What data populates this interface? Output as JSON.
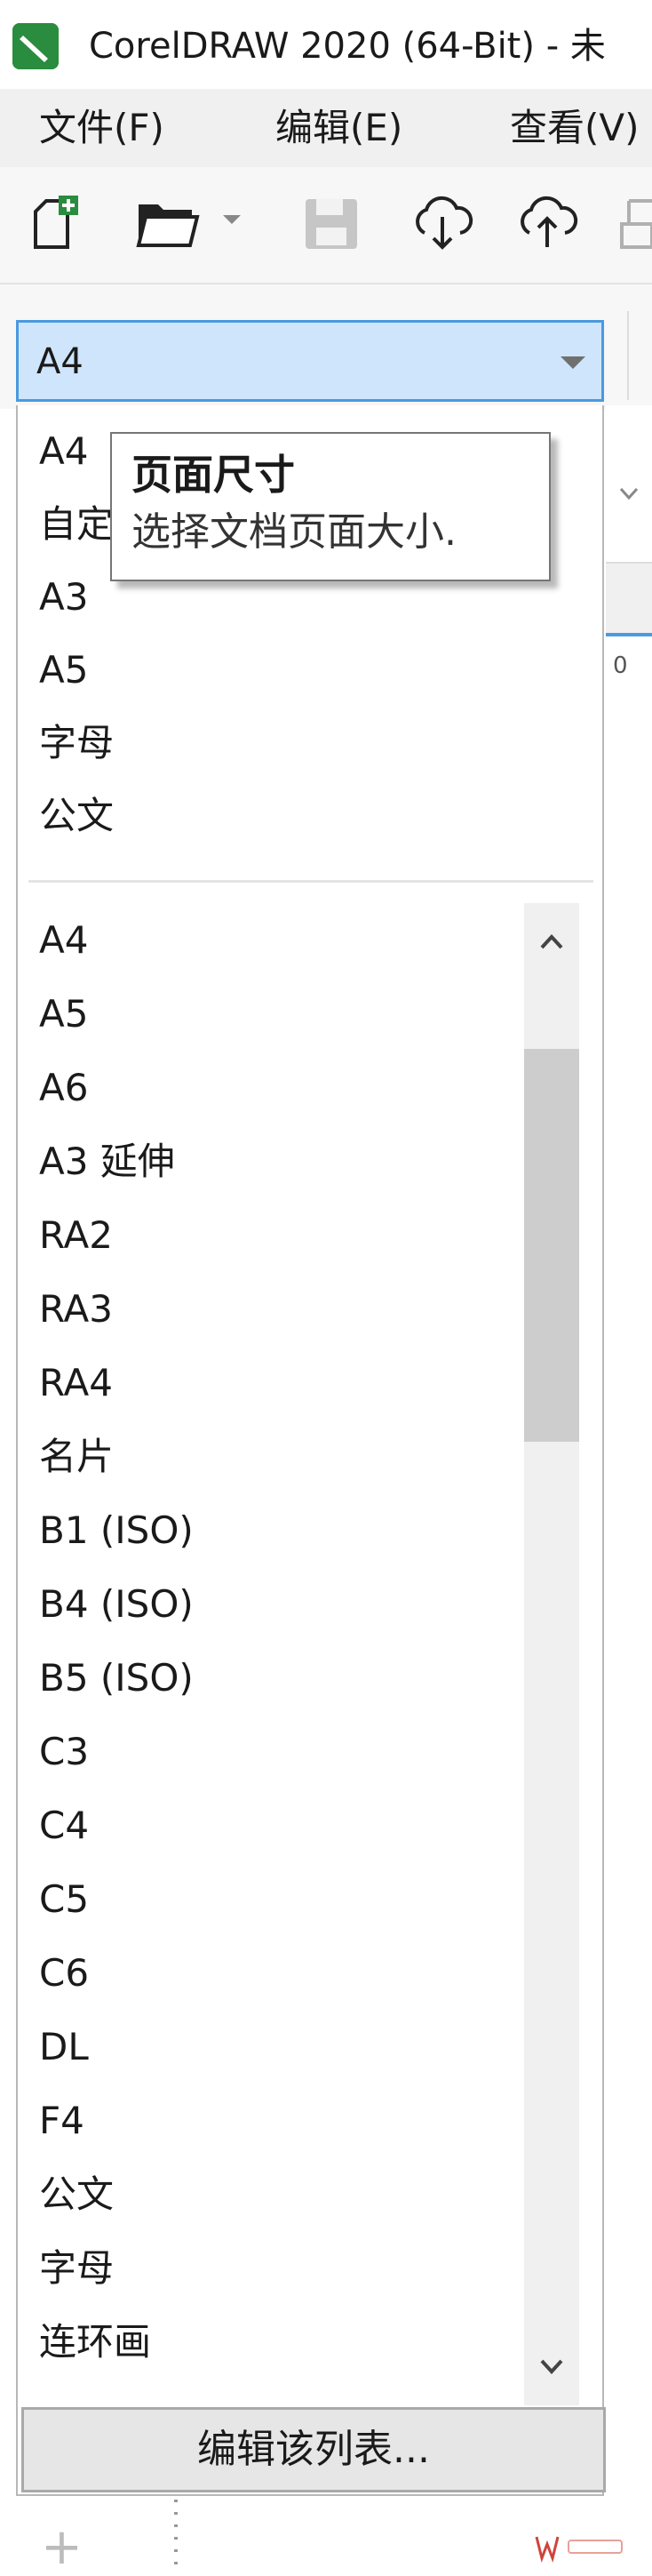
{
  "window": {
    "title": "CorelDRAW 2020 (64-Bit) - 未"
  },
  "menu": [
    "文件(F)",
    "编辑(E)",
    "查看(V)"
  ],
  "toolbar": {
    "icons": [
      "new-document-icon",
      "open-folder-icon",
      "open-dropdown-icon",
      "save-icon",
      "cloud-download-icon",
      "cloud-upload-icon",
      "print-icon"
    ]
  },
  "page_size": {
    "selected": "A4",
    "recent": [
      "A4",
      "自定",
      "A3",
      "A5",
      "字母",
      "公文"
    ],
    "all": [
      "A4",
      "A5",
      "A6",
      "A3 延伸",
      "RA2",
      "RA3",
      "RA4",
      "名片",
      "B1 (ISO)",
      "B4 (ISO)",
      "B5 (ISO)",
      "C3",
      "C4",
      "C5",
      "C6",
      "DL",
      "F4",
      "公文",
      "字母",
      "连环画"
    ],
    "edit_list_label": "编辑该列表..."
  },
  "tooltip": {
    "title": "页面尺寸",
    "description": "选择文档页面大小."
  },
  "background": {
    "ruler_tick": "0"
  },
  "colors": {
    "accent": "#4a9ae0",
    "combo_bg": "#cfe5fb",
    "logo_green": "#2a8c3e"
  }
}
